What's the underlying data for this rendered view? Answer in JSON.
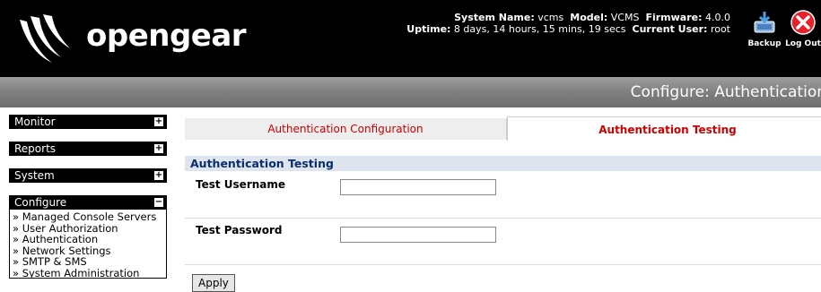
{
  "header": {
    "logo_text": "opengear",
    "system_name_label": "System Name:",
    "system_name": "vcms",
    "model_label": "Model:",
    "model": "VCMS",
    "firmware_label": "Firmware:",
    "firmware": "4.0.0",
    "uptime_label": "Uptime:",
    "uptime": "8 days, 14 hours, 15 mins, 19 secs",
    "current_user_label": "Current User:",
    "current_user": "root",
    "backup_label": "Backup",
    "logout_label": "Log Out",
    "backup_icon": "backup-icon",
    "logout_icon": "close-icon"
  },
  "titlebar": {
    "title": "Configure: Authentication"
  },
  "sidebar": {
    "monitor": "Monitor",
    "reports": "Reports",
    "system": "System",
    "configure": "Configure",
    "expand_symbol": "+",
    "collapse_symbol": "−",
    "configure_items": [
      "Managed Console Servers",
      "User Authorization",
      "Authentication",
      "Network Settings",
      "SMTP & SMS",
      "System Administration"
    ]
  },
  "main": {
    "tabs": [
      "Authentication Configuration",
      "Authentication Testing"
    ],
    "active_tab": "Authentication Testing",
    "section_title": "Authentication Testing",
    "username_label": "Test Username",
    "username_value": "",
    "password_label": "Test Password",
    "password_value": "",
    "apply_label": "Apply"
  },
  "colors": {
    "header_bg": "#000000",
    "tab_text": "#cc0000",
    "section_bg": "#dfe5ee",
    "section_text": "#0a2f6c"
  }
}
